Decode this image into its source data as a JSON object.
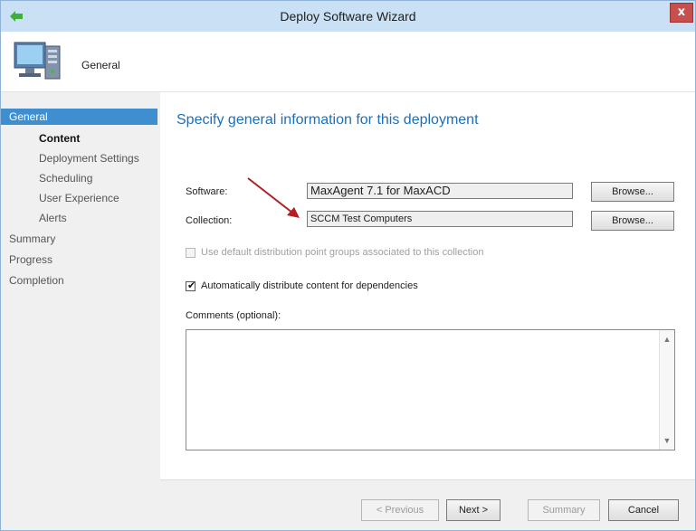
{
  "window": {
    "title": "Deploy Software Wizard",
    "close_glyph": "x"
  },
  "header": {
    "page_label": "General",
    "icon": "computer-deploy-icon"
  },
  "nav": {
    "items": [
      {
        "label": "General",
        "state": "active"
      },
      {
        "label": "Content",
        "state": "current"
      },
      {
        "label": "Deployment Settings",
        "state": "normal"
      },
      {
        "label": "Scheduling",
        "state": "normal"
      },
      {
        "label": "User Experience",
        "state": "normal"
      },
      {
        "label": "Alerts",
        "state": "normal"
      },
      {
        "label": "Summary",
        "state": "normal"
      },
      {
        "label": "Progress",
        "state": "normal"
      },
      {
        "label": "Completion",
        "state": "normal"
      }
    ]
  },
  "main": {
    "heading": "Specify general information for this deployment",
    "software": {
      "label": "Software:",
      "value": "MaxAgent 7.1 for MaxACD",
      "browse_label": "Browse..."
    },
    "collection": {
      "label": "Collection:",
      "value": "SCCM Test Computers",
      "browse_label": "Browse..."
    },
    "use_default_dp": {
      "label": "Use default distribution point groups associated to this collection",
      "checked": false,
      "enabled": false
    },
    "auto_distribute": {
      "label": "Automatically distribute content for dependencies",
      "checked": true,
      "enabled": true
    },
    "comments": {
      "label": "Comments (optional):",
      "value": ""
    }
  },
  "buttons": {
    "previous": "< Previous",
    "next": "Next >",
    "summary": "Summary",
    "cancel": "Cancel"
  },
  "colors": {
    "accent": "#3e8ed0",
    "heading": "#1d6fb8",
    "titlebar": "#c9e0f5",
    "close": "#c7504f",
    "annotation_arrow": "#b11f24"
  },
  "check_glyph": "✔",
  "scroll": {
    "up_glyph": "▲",
    "down_glyph": "▼"
  }
}
